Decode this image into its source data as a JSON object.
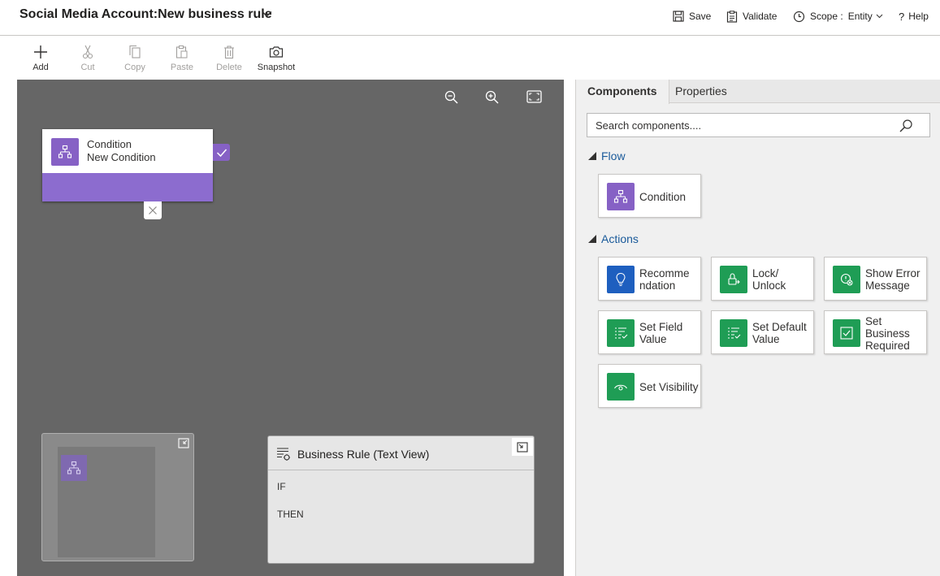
{
  "header": {
    "title": "Social Media Account:New business rule",
    "save_label": "Save",
    "validate_label": "Validate",
    "scope_label": "Scope :",
    "scope_value": "Entity",
    "help_label": "Help"
  },
  "toolbar": {
    "add": "Add",
    "cut": "Cut",
    "copy": "Copy",
    "paste": "Paste",
    "delete": "Delete",
    "snapshot": "Snapshot"
  },
  "canvas": {
    "condition_type": "Condition",
    "condition_name": "New Condition",
    "text_view": {
      "title": "Business Rule (Text View)",
      "if_label": "IF",
      "then_label": "THEN"
    }
  },
  "panel": {
    "tabs": [
      "Components",
      "Properties"
    ],
    "active_tab": "Components",
    "search_placeholder": "Search components....",
    "flow": {
      "title": "Flow",
      "items": [
        {
          "label": "Condition",
          "color": "#8661c5",
          "icon": "condition-icon"
        }
      ]
    },
    "actions": {
      "title": "Actions",
      "items": [
        {
          "label": "Recomme ndation",
          "color": "#1e5fbf",
          "icon": "lightbulb-icon"
        },
        {
          "label": "Lock/ Unlock",
          "color": "#1f9d55",
          "icon": "lock-icon"
        },
        {
          "label": "Show Error Message",
          "color": "#1f9d55",
          "icon": "error-message-icon"
        },
        {
          "label": "Set Field Value",
          "color": "#1f9d55",
          "icon": "set-field-icon"
        },
        {
          "label": "Set Default Value",
          "color": "#1f9d55",
          "icon": "set-default-icon"
        },
        {
          "label": "Set Business Required",
          "color": "#1f9d55",
          "icon": "checkbox-icon"
        },
        {
          "label": "Set Visibility",
          "color": "#1f9d55",
          "icon": "eye-icon"
        }
      ]
    }
  }
}
